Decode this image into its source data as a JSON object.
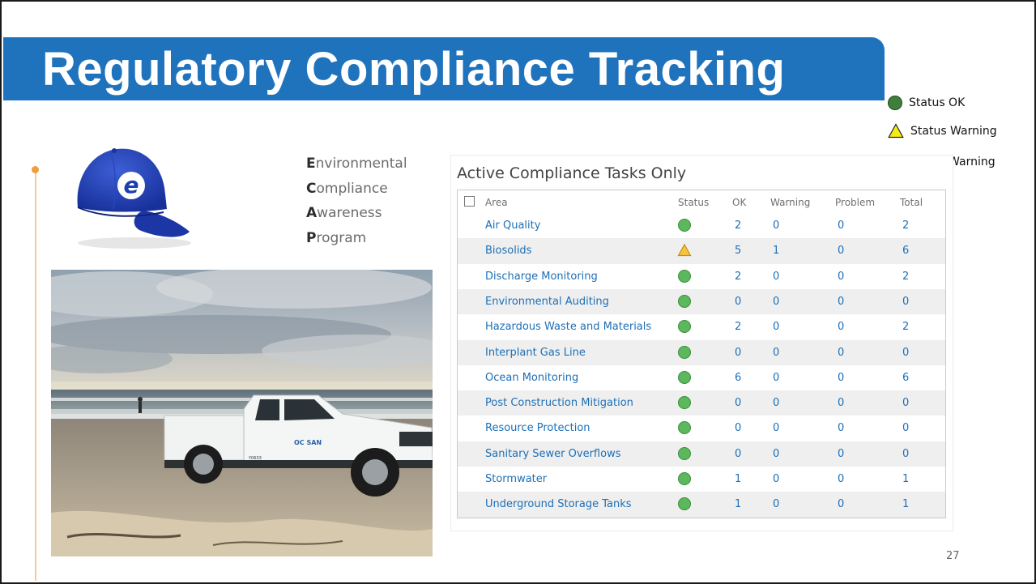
{
  "slide": {
    "title": "Regulatory Compliance Tracking",
    "page_number": "27"
  },
  "legend": [
    {
      "icon": "green-circle-icon",
      "color": "#3e7f3b",
      "label": "Status OK"
    },
    {
      "icon": "yellow-triangle-icon",
      "color": "#f5ec15",
      "label": "Status Warning"
    },
    {
      "icon": "red-circle-icon",
      "color": "#e0191c",
      "label": "Status Warning"
    }
  ],
  "cap": {
    "letter": "e"
  },
  "acronym": [
    {
      "first": "E",
      "rest": "nvironmental"
    },
    {
      "first": "C",
      "rest": "ompliance"
    },
    {
      "first": "A",
      "rest": "wareness"
    },
    {
      "first": "P",
      "rest": "rogram"
    }
  ],
  "photo": {
    "truck_logo": "OC SAN",
    "truck_number": "Y0633"
  },
  "table": {
    "title": "Active Compliance Tasks Only",
    "headers": {
      "area": "Area",
      "status": "Status",
      "ok": "OK",
      "warning": "Warning",
      "problem": "Problem",
      "total": "Total"
    },
    "rows": [
      {
        "area": "Air Quality",
        "status": "ok",
        "ok": "2",
        "warning": "0",
        "problem": "0",
        "total": "2"
      },
      {
        "area": "Biosolids",
        "status": "warning",
        "ok": "5",
        "warning": "1",
        "problem": "0",
        "total": "6"
      },
      {
        "area": "Discharge Monitoring",
        "status": "ok",
        "ok": "2",
        "warning": "0",
        "problem": "0",
        "total": "2"
      },
      {
        "area": "Environmental Auditing",
        "status": "ok",
        "ok": "0",
        "warning": "0",
        "problem": "0",
        "total": "0"
      },
      {
        "area": "Hazardous Waste and Materials",
        "status": "ok",
        "ok": "2",
        "warning": "0",
        "problem": "0",
        "total": "2"
      },
      {
        "area": "Interplant Gas Line",
        "status": "ok",
        "ok": "0",
        "warning": "0",
        "problem": "0",
        "total": "0"
      },
      {
        "area": "Ocean Monitoring",
        "status": "ok",
        "ok": "6",
        "warning": "0",
        "problem": "0",
        "total": "6"
      },
      {
        "area": "Post Construction Mitigation",
        "status": "ok",
        "ok": "0",
        "warning": "0",
        "problem": "0",
        "total": "0"
      },
      {
        "area": "Resource Protection",
        "status": "ok",
        "ok": "0",
        "warning": "0",
        "problem": "0",
        "total": "0"
      },
      {
        "area": "Sanitary Sewer Overflows",
        "status": "ok",
        "ok": "0",
        "warning": "0",
        "problem": "0",
        "total": "0"
      },
      {
        "area": "Stormwater",
        "status": "ok",
        "ok": "1",
        "warning": "0",
        "problem": "0",
        "total": "1"
      },
      {
        "area": "Underground Storage Tanks",
        "status": "ok",
        "ok": "1",
        "warning": "0",
        "problem": "0",
        "total": "1"
      }
    ]
  },
  "colors": {
    "title_bar": "#1f73bd",
    "link": "#1d6fb6",
    "accent": "#f39c3d",
    "cap": "#1e3fae"
  }
}
